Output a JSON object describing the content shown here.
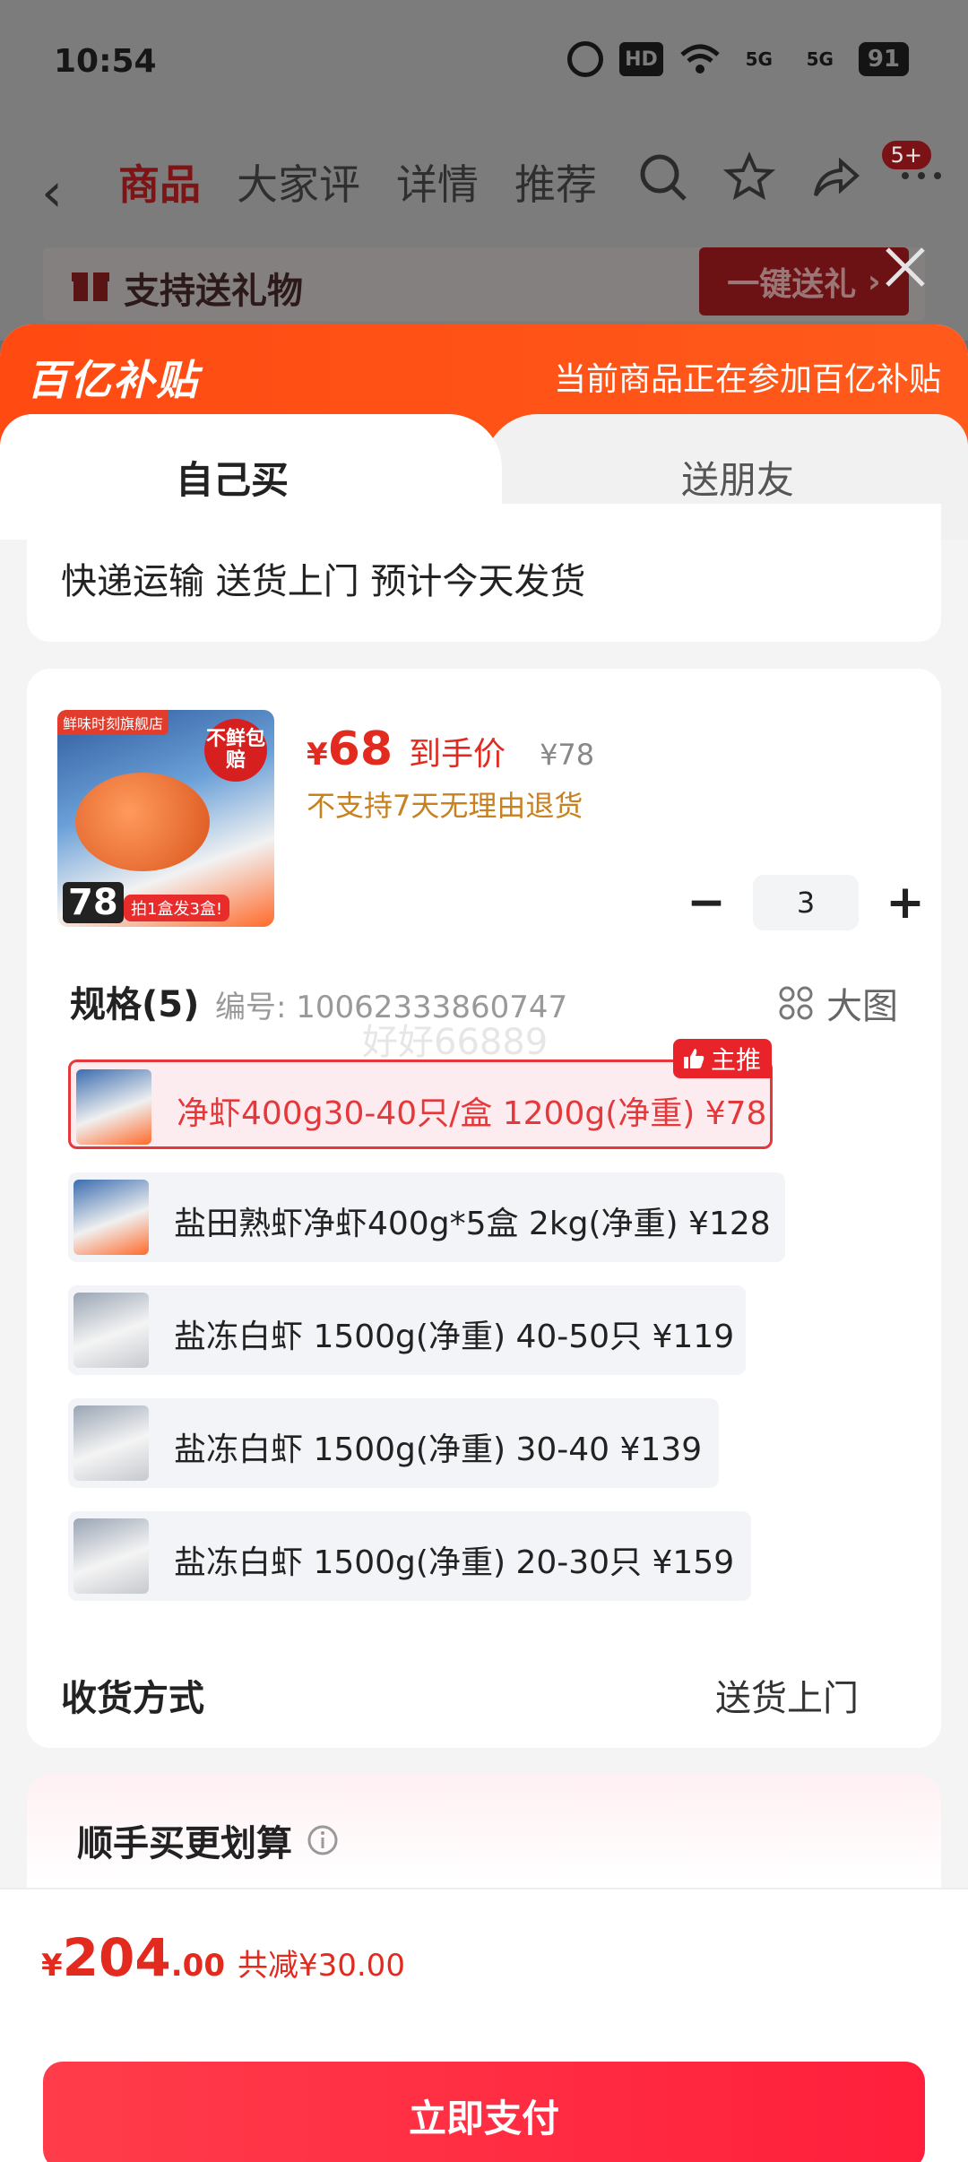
{
  "status_bar": {
    "time": "10:54",
    "hd": "HD",
    "net1": "5G",
    "net2": "5G",
    "battery": "91"
  },
  "nav": {
    "tabs": [
      "商品",
      "大家评",
      "详情",
      "推荐"
    ],
    "active_tab": "商品",
    "badge": "5+"
  },
  "gift_bar": {
    "text": "支持送礼物",
    "button": "一键送礼"
  },
  "subsidy": {
    "logo": "百亿补贴",
    "note": "当前商品正在参加百亿补贴"
  },
  "buy_tabs": {
    "self": "自己买",
    "gift": "送朋友"
  },
  "delivery": {
    "text": "快递运输 送货上门 预计今天发货"
  },
  "product": {
    "image": {
      "shop_tag": "鲜味时刻旗舰店",
      "seal": "不鲜包赔",
      "price_tag": "78",
      "ribbon": "拍1盒发3盒!"
    },
    "currency": "¥",
    "price": "68",
    "price_tag": "到手价",
    "original_price": "¥78",
    "return_note": "不支持7天无理由退货",
    "quantity": "3",
    "minus": "−",
    "plus": "+"
  },
  "spec": {
    "title": "规格(5)",
    "code": "编号: 10062333860747",
    "big_pic": "大图",
    "watermark": "好好66889",
    "recommend_badge": "主推",
    "options": [
      {
        "label": "净虾400g30-40只/盒 1200g(净重)  ¥78",
        "selected": true
      },
      {
        "label": "盐田熟虾净虾400g*5盒 2kg(净重)  ¥128",
        "selected": false
      },
      {
        "label": "盐冻白虾 1500g(净重)  40-50只  ¥119",
        "selected": false
      },
      {
        "label": "盐冻白虾 1500g(净重)  30-40  ¥139",
        "selected": false
      },
      {
        "label": "盐冻白虾 1500g(净重)  20-30只  ¥159",
        "selected": false
      }
    ]
  },
  "shipping": {
    "label": "收货方式",
    "value": "送货上门"
  },
  "addon": {
    "title": "顺手买更划算"
  },
  "bottom": {
    "currency": "¥",
    "total_int": "204",
    "total_dec": ".00",
    "discount": "共减¥30.00",
    "pay_button": "立即支付"
  },
  "colors": {
    "accent_red": "#e22a1f",
    "subsidy_orange": "#ff4a12",
    "pay_red": "#ff1f3c"
  }
}
